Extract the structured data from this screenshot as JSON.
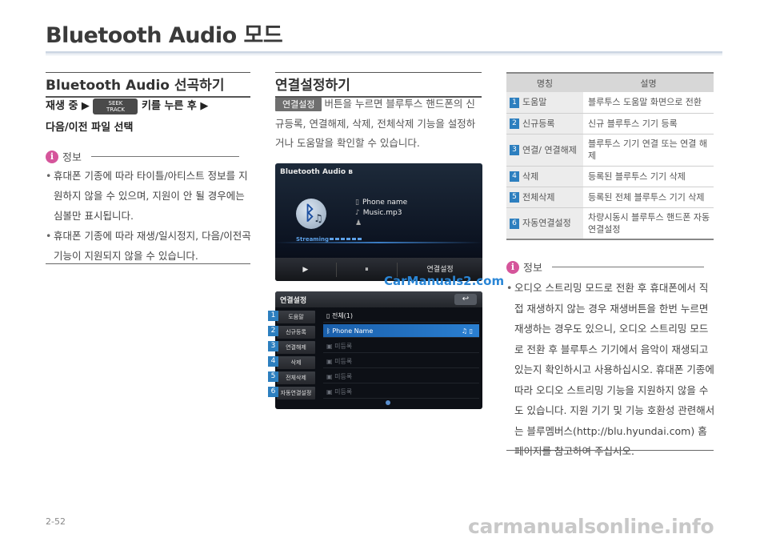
{
  "page": {
    "title": "Bluetooth Audio 모드",
    "page_number": "2-52",
    "footer_watermark": "carmanualsonline.info",
    "center_watermark": "CarManuals2.com"
  },
  "select_track": {
    "heading": "Bluetooth Audio 선곡하기",
    "step1_prefix": "재생 중 ▶",
    "seek_button_line1": "SEEK",
    "seek_button_line2": "TRACK",
    "step1_suffix": "키를 누른 후 ▶",
    "step2": "다음/이전 파일 선택",
    "info_label": "정보",
    "bullets": [
      "휴대폰 기종에 따라 타이틀/아티스트 정보를 지원하지 않을 수 있으며, 지원이 안 될 경우에는 심볼만 표시됩니다.",
      "휴대폰 기종에 따라 재생/일시정지, 다음/이전곡 기능이 지원되지 않을 수 있습니다."
    ]
  },
  "connection_settings": {
    "heading": "연결설정하기",
    "chip": "연결설정",
    "paragraph": "버튼을 누르면 블루투스 핸드폰의 신규등록, 연결해제, 삭제, 전체삭제 기능을 설정하거나 도움말을 확인할 수 있습니다.",
    "screen1": {
      "title": "Bluetooth Audio",
      "phone_name": "Phone name",
      "music_file": "Music.mp3",
      "streaming": "Streaming",
      "controls": [
        "▶",
        "⏸",
        "연결설정"
      ]
    },
    "screen2": {
      "title": "연결설정",
      "back": "↩",
      "menu": [
        "도움말",
        "신규등록",
        "연결해제",
        "삭제",
        "전체삭제",
        "자동연결설정"
      ],
      "rows": [
        "전체(1)",
        "Phone Name",
        "미등록",
        "미등록",
        "미등록",
        "미등록"
      ]
    },
    "badges": [
      "1",
      "2",
      "3",
      "4",
      "5",
      "6"
    ]
  },
  "table": {
    "header": [
      "명칭",
      "설명"
    ],
    "rows": [
      {
        "num": "1",
        "name": "도움말",
        "desc": "블루투스 도움말 화면으로 전환"
      },
      {
        "num": "2",
        "name": "신규등록",
        "desc": "신규 블루투스 기기 등록"
      },
      {
        "num": "3",
        "name": "연결/ 연결해제",
        "desc": "블루투스 기기 연결 또는 연결 해제"
      },
      {
        "num": "4",
        "name": "삭제",
        "desc": "등록된 블루투스 기기 삭제"
      },
      {
        "num": "5",
        "name": "전체삭제",
        "desc": "등록된 전체 블루투스 기기 삭제"
      },
      {
        "num": "6",
        "name": "자동연결설정",
        "desc": "차량시동시 블루투스 핸드폰 자동연결설정"
      }
    ]
  },
  "info2": {
    "label": "정보",
    "bullet": "오디오 스트리밍 모드로 전환 후 휴대폰에서 직접 재생하지 않는 경우 재생버튼을 한번 누르면 재생하는 경우도 있으니, 오디오 스트리밍 모드로 전환 후 블루투스 기기에서 음악이 재생되고 있는지 확인하시고 사용하십시오. 휴대폰 기종에 따라 오디오 스트리밍 기능을 지원하지 않을 수도 있습니다. 지원 기기 및 기능 호환성 관련해서는 블루멤버스(http://blu.hyundai.com) 홈페이지를 참고하여 주십시오."
  },
  "colors": {
    "accent_blue": "#2d7fbf",
    "info_pink": "#d5559b",
    "table_header": "#d7d7d7"
  }
}
